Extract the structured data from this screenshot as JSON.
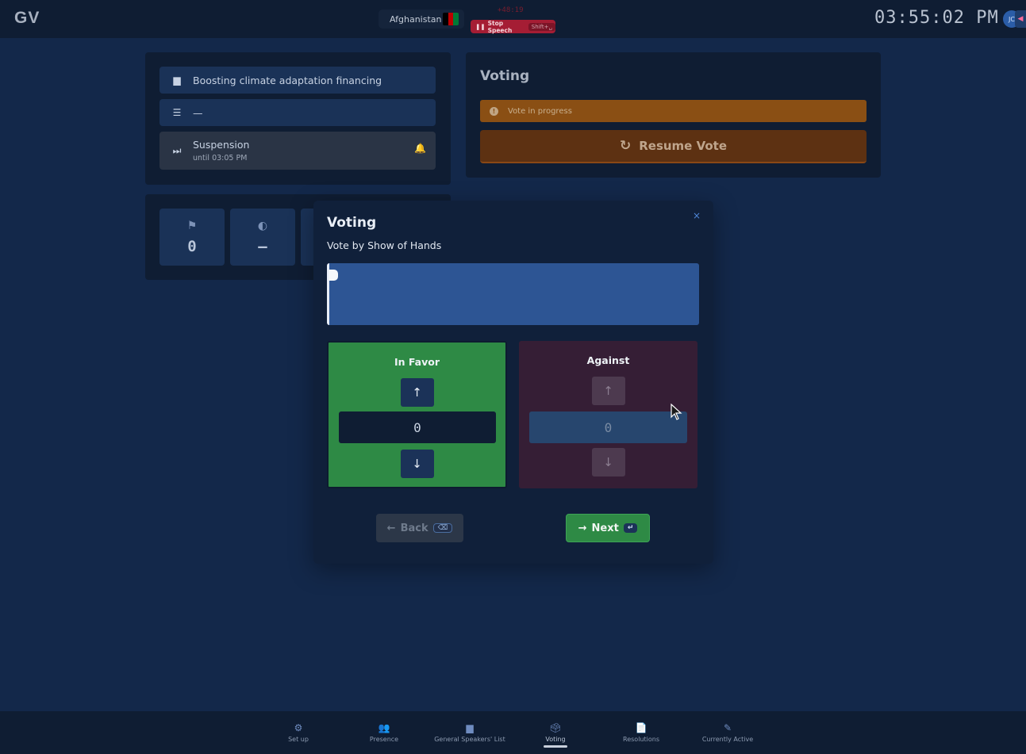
{
  "header": {
    "logo": "GV",
    "country": "Afghanistan",
    "speech_timer": "+48:19",
    "stop_speech_label": "Stop Speech",
    "stop_speech_shortcut": "Shift+␣",
    "clock": "03:55:02 PM",
    "avatar_initials": "JC",
    "flag_colors": [
      "#000000",
      "#be0000",
      "#007a36"
    ]
  },
  "session": {
    "topic": "Boosting climate adaptation financing",
    "subtopic": "—",
    "status_title": "Suspension",
    "status_until": "until 03:05 PM"
  },
  "stats": [
    {
      "icon": "flag-icon",
      "value": "0"
    },
    {
      "icon": "half-circle-icon",
      "value": "–"
    }
  ],
  "voting_card": {
    "title": "Voting",
    "status": "Vote in progress",
    "resume_label": "Resume Vote"
  },
  "modal": {
    "title": "Voting",
    "close": "×",
    "subtitle": "Vote by Show of Hands",
    "favor": {
      "label": "In Favor",
      "count": "0"
    },
    "against": {
      "label": "Against",
      "count": "0"
    },
    "back_label": "Back",
    "back_shortcut": "⌫",
    "next_label": "Next",
    "next_shortcut": "↵"
  },
  "bottom_nav": [
    {
      "label": "Set up",
      "icon": "gears-icon",
      "active": false
    },
    {
      "label": "Presence",
      "icon": "people-icon",
      "active": false
    },
    {
      "label": "General Speakers' List",
      "icon": "podium-icon",
      "active": false
    },
    {
      "label": "Voting",
      "icon": "ballot-box-icon",
      "active": true
    },
    {
      "label": "Resolutions",
      "icon": "document-icon",
      "active": false
    },
    {
      "label": "Currently Active",
      "icon": "file-pen-icon",
      "active": false
    }
  ],
  "colors": {
    "background": "#13284a",
    "panel": "#0f1d33",
    "accent_green": "#2e8a45",
    "accent_orange": "#8a4f14",
    "danger": "#a51d34"
  }
}
